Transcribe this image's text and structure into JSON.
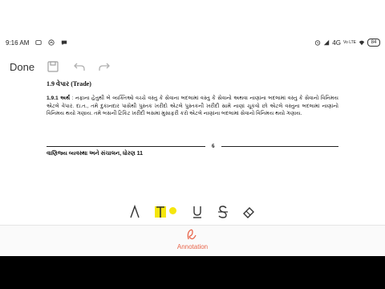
{
  "status": {
    "time": "9:16 AM",
    "network": "4G",
    "volte": "Vo LTE",
    "battery": "84"
  },
  "toolbar": {
    "done_label": "Done"
  },
  "document": {
    "heading": "1.9 વેપાર (Trade)",
    "para_num": "1.9.1",
    "para_key": "અર્થ",
    "para_text": ": નફાના હેતુથી બે વ્યક્તિઓ વચ્ચે વસ્તુ કે સેવાના બદલામાં વસ્તુ કે સેવાનો અથવા નાણાંના બદલામાં વસ્તુ કે સેવાનો વિનિમય એટલે વેપાર. દા.ત., તમે દુકાનદાર પાસેથી પુસ્તક ખરીદો એટલે પુસ્તકની ખરીદી સામે નાણાં ચૂકવો છો એટલે વસ્તુના બદલામાં નાણાંનો વિનિમય થયો ગણાય. તમે બસની ટિકિટ ખરીદી બસમાં મુસાફરી કરો એટલે નાણાંના બદલામાં સેવાનો વિનિમય થયો ગણાય.",
    "page_number": "6",
    "footer": "વાણિજ્ય વ્યવસ્થા અને સંચાલન, ધોરણ 11"
  },
  "bottom": {
    "annotation_label": "Annotation"
  },
  "colors": {
    "accent": "#e8654a",
    "highlight": "#f5e60d"
  }
}
